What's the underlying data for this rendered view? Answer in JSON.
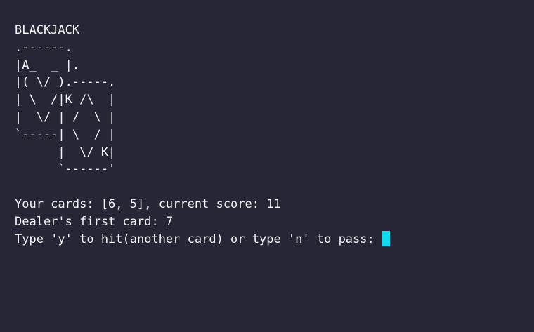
{
  "terminal": {
    "title": "BLACKJACK",
    "art": [
      ".------.",
      "|A_  _ |.",
      "|( \\/ ).-----.",
      "| \\  /|K /\\  |",
      "|  \\/ | /  \\ |",
      "`-----| \\  / |",
      "      |  \\/ K|",
      "      `------'"
    ],
    "your_cards": "Your cards: [6, 5], current score: 11",
    "dealer_card": "Dealer's first card: 7",
    "prompt": "Type 'y' to hit(another card) or type 'n' to pass: "
  },
  "colors": {
    "background": "#262637",
    "text": "#f4f4f4",
    "cursor": "#14d9ec"
  }
}
